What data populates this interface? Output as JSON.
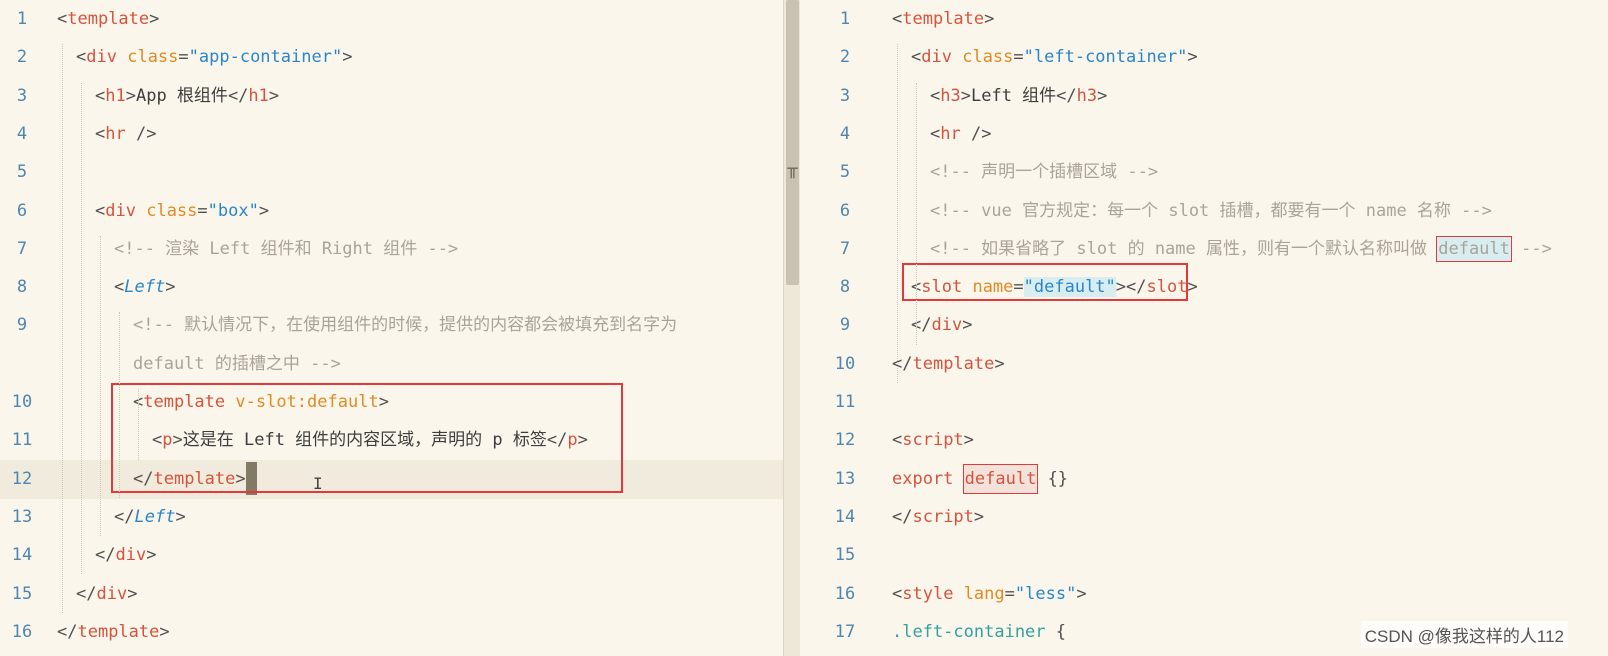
{
  "left_editor": {
    "lines": [
      {
        "num": "1",
        "tokens": [
          [
            "punct",
            "<"
          ],
          [
            "tag",
            "template"
          ],
          [
            "punct",
            ">"
          ]
        ]
      },
      {
        "num": "2",
        "tokens": [
          [
            "punct",
            "<"
          ],
          [
            "tag",
            "div"
          ],
          [
            "punct",
            " "
          ],
          [
            "attr",
            "class"
          ],
          [
            "punct",
            "="
          ],
          [
            "str",
            "\"app-container\""
          ],
          [
            "punct",
            ">"
          ]
        ]
      },
      {
        "num": "3",
        "tokens": [
          [
            "punct",
            "<"
          ],
          [
            "tag",
            "h1"
          ],
          [
            "punct",
            ">"
          ],
          [
            "txt",
            "App 根组件"
          ],
          [
            "punct",
            "</"
          ],
          [
            "tag",
            "h1"
          ],
          [
            "punct",
            ">"
          ]
        ]
      },
      {
        "num": "4",
        "tokens": [
          [
            "punct",
            "<"
          ],
          [
            "tag",
            "hr"
          ],
          [
            "punct",
            " />"
          ]
        ]
      },
      {
        "num": "5",
        "tokens": []
      },
      {
        "num": "6",
        "tokens": [
          [
            "punct",
            "<"
          ],
          [
            "tag",
            "div"
          ],
          [
            "punct",
            " "
          ],
          [
            "attr",
            "class"
          ],
          [
            "punct",
            "="
          ],
          [
            "str",
            "\"box\""
          ],
          [
            "punct",
            ">"
          ]
        ]
      },
      {
        "num": "7",
        "tokens": [
          [
            "cmt",
            "<!-- 渲染 Left 组件和 Right 组件 -->"
          ]
        ]
      },
      {
        "num": "8",
        "tokens": [
          [
            "punct",
            "<"
          ],
          [
            "comp",
            "Left"
          ],
          [
            "punct",
            ">"
          ]
        ]
      },
      {
        "num": "9",
        "tokens": [
          [
            "cmt",
            "<!-- 默认情况下，在使用组件的时候，提供的内容都会被填充到名字为"
          ]
        ]
      },
      {
        "num": "",
        "tokens": [
          [
            "cmt",
            "default 的插槽之中 -->"
          ]
        ]
      },
      {
        "num": "10",
        "tokens": [
          [
            "punct",
            "<"
          ],
          [
            "tag",
            "template"
          ],
          [
            "punct",
            " "
          ],
          [
            "attr",
            "v-slot:default"
          ],
          [
            "punct",
            ">"
          ]
        ]
      },
      {
        "num": "11",
        "tokens": [
          [
            "punct",
            "<"
          ],
          [
            "tag",
            "p"
          ],
          [
            "punct",
            ">"
          ],
          [
            "txt",
            "这是在 Left 组件的内容区域，声明的 p 标签"
          ],
          [
            "punct",
            "</"
          ],
          [
            "tag",
            "p"
          ],
          [
            "punct",
            ">"
          ]
        ]
      },
      {
        "num": "12",
        "tokens": [
          [
            "punct",
            "</"
          ],
          [
            "tag",
            "template"
          ],
          [
            "punct",
            ">"
          ]
        ]
      },
      {
        "num": "13",
        "tokens": [
          [
            "punct",
            "</"
          ],
          [
            "comp",
            "Left"
          ],
          [
            "punct",
            ">"
          ]
        ]
      },
      {
        "num": "14",
        "tokens": [
          [
            "punct",
            "</"
          ],
          [
            "tag",
            "div"
          ],
          [
            "punct",
            ">"
          ]
        ]
      },
      {
        "num": "15",
        "tokens": [
          [
            "punct",
            "</"
          ],
          [
            "tag",
            "div"
          ],
          [
            "punct",
            ">"
          ]
        ]
      },
      {
        "num": "16",
        "tokens": [
          [
            "punct",
            "</"
          ],
          [
            "tag",
            "template"
          ],
          [
            "punct",
            ">"
          ]
        ]
      }
    ]
  },
  "right_editor": {
    "lines": [
      {
        "num": "1",
        "tokens": [
          [
            "punct",
            "<"
          ],
          [
            "tag",
            "template"
          ],
          [
            "punct",
            ">"
          ]
        ]
      },
      {
        "num": "2",
        "tokens": [
          [
            "punct",
            "<"
          ],
          [
            "tag",
            "div"
          ],
          [
            "punct",
            " "
          ],
          [
            "attr",
            "class"
          ],
          [
            "punct",
            "="
          ],
          [
            "str",
            "\"left-container\""
          ],
          [
            "punct",
            ">"
          ]
        ]
      },
      {
        "num": "3",
        "tokens": [
          [
            "punct",
            "<"
          ],
          [
            "tag",
            "h3"
          ],
          [
            "punct",
            ">"
          ],
          [
            "txt",
            "Left 组件"
          ],
          [
            "punct",
            "</"
          ],
          [
            "tag",
            "h3"
          ],
          [
            "punct",
            ">"
          ]
        ]
      },
      {
        "num": "4",
        "tokens": [
          [
            "punct",
            "<"
          ],
          [
            "tag",
            "hr"
          ],
          [
            "punct",
            " />"
          ]
        ]
      },
      {
        "num": "5",
        "tokens": [
          [
            "cmt",
            "<!-- 声明一个插槽区域 -->"
          ]
        ]
      },
      {
        "num": "6",
        "tokens": [
          [
            "cmt",
            "<!-- vue 官方规定：每一个 slot 插槽，都要有一个 name 名称 -->"
          ]
        ]
      },
      {
        "num": "7",
        "tokens": [
          [
            "cmt",
            "<!-- 如果省略了 slot 的 name 属性，则有一个默认名称叫做 "
          ],
          [
            "cmtbox",
            "default"
          ],
          [
            "cmt",
            " -->"
          ]
        ]
      },
      {
        "num": "8",
        "tokens": [
          [
            "punct",
            "<"
          ],
          [
            "tag",
            "slot"
          ],
          [
            "punct",
            " "
          ],
          [
            "attr",
            "name"
          ],
          [
            "punct",
            "="
          ],
          [
            "strhl",
            "\"default\""
          ],
          [
            "punct",
            "></"
          ],
          [
            "tag",
            "slot"
          ],
          [
            "punct",
            ">"
          ]
        ]
      },
      {
        "num": "9",
        "tokens": [
          [
            "punct",
            "</"
          ],
          [
            "tag",
            "div"
          ],
          [
            "punct",
            ">"
          ]
        ]
      },
      {
        "num": "10",
        "tokens": [
          [
            "punct",
            "</"
          ],
          [
            "tag",
            "template"
          ],
          [
            "punct",
            ">"
          ]
        ]
      },
      {
        "num": "11",
        "tokens": []
      },
      {
        "num": "12",
        "tokens": [
          [
            "punct",
            "<"
          ],
          [
            "tag",
            "script"
          ],
          [
            "punct",
            ">"
          ]
        ]
      },
      {
        "num": "13",
        "tokens": [
          [
            "kw",
            "export"
          ],
          [
            "punct",
            " "
          ],
          [
            "kwbox",
            "default"
          ],
          [
            "punct",
            " {}"
          ]
        ]
      },
      {
        "num": "14",
        "tokens": [
          [
            "punct",
            "</"
          ],
          [
            "tag",
            "script"
          ],
          [
            "punct",
            ">"
          ]
        ]
      },
      {
        "num": "15",
        "tokens": []
      },
      {
        "num": "16",
        "tokens": [
          [
            "punct",
            "<"
          ],
          [
            "tag",
            "style"
          ],
          [
            "punct",
            " "
          ],
          [
            "attr",
            "lang"
          ],
          [
            "punct",
            "="
          ],
          [
            "str",
            "\"less\""
          ],
          [
            "punct",
            ">"
          ]
        ]
      },
      {
        "num": "17",
        "tokens": [
          [
            "sel",
            ".left-container"
          ],
          [
            "punct",
            " {"
          ]
        ]
      }
    ]
  },
  "watermark": "CSDN @像我这样的人112",
  "colors": {
    "background": "#fbf6ec",
    "tag": "#d6533c",
    "attr": "#e08b23",
    "string": "#2a86c9",
    "comment": "#a9a398",
    "line_number": "#4d86b0",
    "highlight_box": "#e23a3a"
  }
}
